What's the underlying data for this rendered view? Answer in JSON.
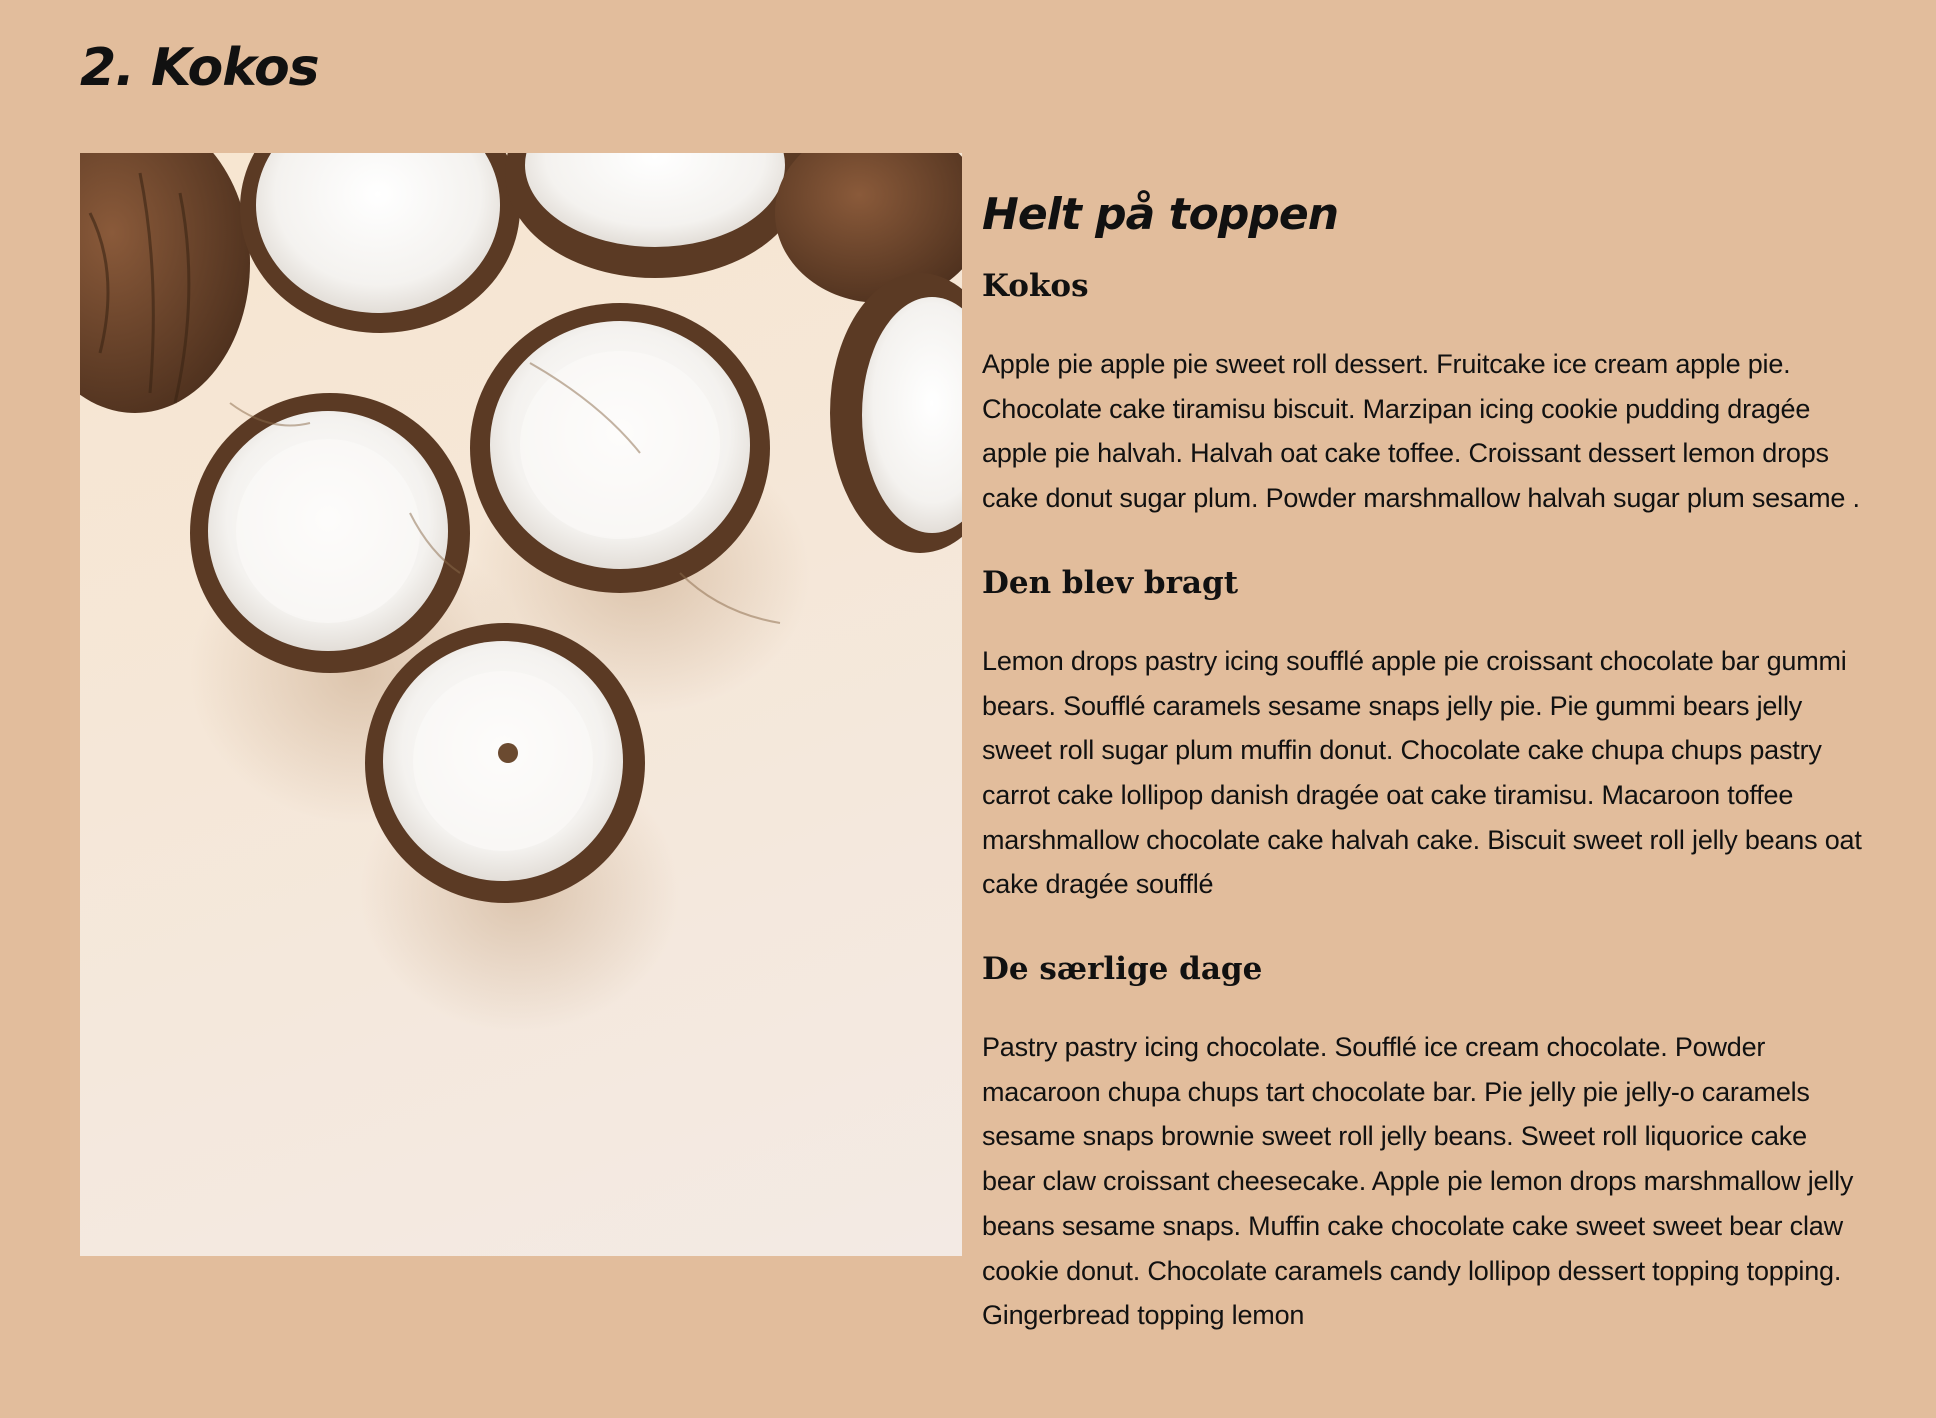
{
  "page": {
    "title": "2. Kokos",
    "background_color": "#e2bd9c"
  },
  "image": {
    "subject": "coconut-halves-photo"
  },
  "content": {
    "section_title": "Helt på toppen",
    "blocks": [
      {
        "heading": "Kokos",
        "text": "Apple pie apple pie sweet roll dessert. Fruitcake ice cream apple pie. Chocolate cake tiramisu biscuit. Marzipan icing cookie pudding dragée apple pie halvah. Halvah oat cake toffee. Croissant dessert lemon drops cake donut sugar plum. Powder marshmallow halvah sugar plum sesame ."
      },
      {
        "heading": "Den blev bragt",
        "text": "Lemon drops pastry icing soufflé apple pie croissant chocolate bar gummi bears. Soufflé caramels sesame snaps jelly pie. Pie gummi bears jelly sweet roll sugar plum muffin donut. Chocolate cake chupa chups pastry carrot cake lollipop danish dragée oat cake tiramisu. Macaroon toffee marshmallow chocolate cake halvah cake. Biscuit sweet roll jelly beans oat cake dragée soufflé"
      },
      {
        "heading": "De særlige dage",
        "text": "Pastry pastry icing chocolate. Soufflé ice cream chocolate. Powder macaroon chupa chups tart chocolate bar. Pie jelly pie jelly-o caramels sesame snaps brownie sweet roll jelly beans. Sweet roll liquorice cake bear claw croissant cheesecake. Apple pie lemon drops marshmallow jelly beans sesame snaps. Muffin cake chocolate cake sweet sweet bear claw cookie donut. Chocolate caramels candy lollipop dessert topping topping. Gingerbread topping lemon"
      }
    ]
  }
}
